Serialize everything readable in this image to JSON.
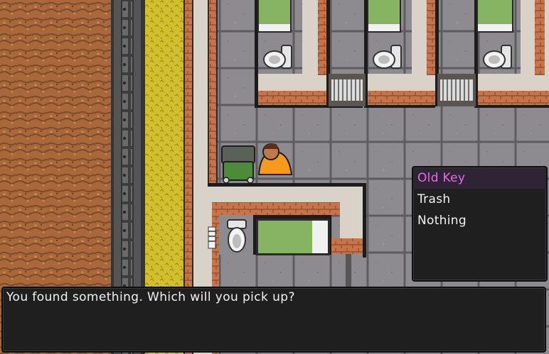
{
  "dialog": {
    "message": "You found something. Which will you pick up?"
  },
  "choices": [
    {
      "label": "Old Key",
      "selected": true
    },
    {
      "label": "Trash",
      "selected": false
    },
    {
      "label": "Nothing",
      "selected": false
    }
  ],
  "colors": {
    "selected_text": "#e86ae8",
    "prisoner_uniform": "#f59a1c",
    "dirt": "#a8683c",
    "grass": "#d2bf2e",
    "floor_tile": "#8d8b8f",
    "bed_sheet": "#86b463",
    "brick": "#c8744a"
  },
  "icons": [
    "prisoner-icon",
    "trash-can-icon",
    "toilet-icon",
    "bed-icon",
    "cell-bars-icon"
  ]
}
